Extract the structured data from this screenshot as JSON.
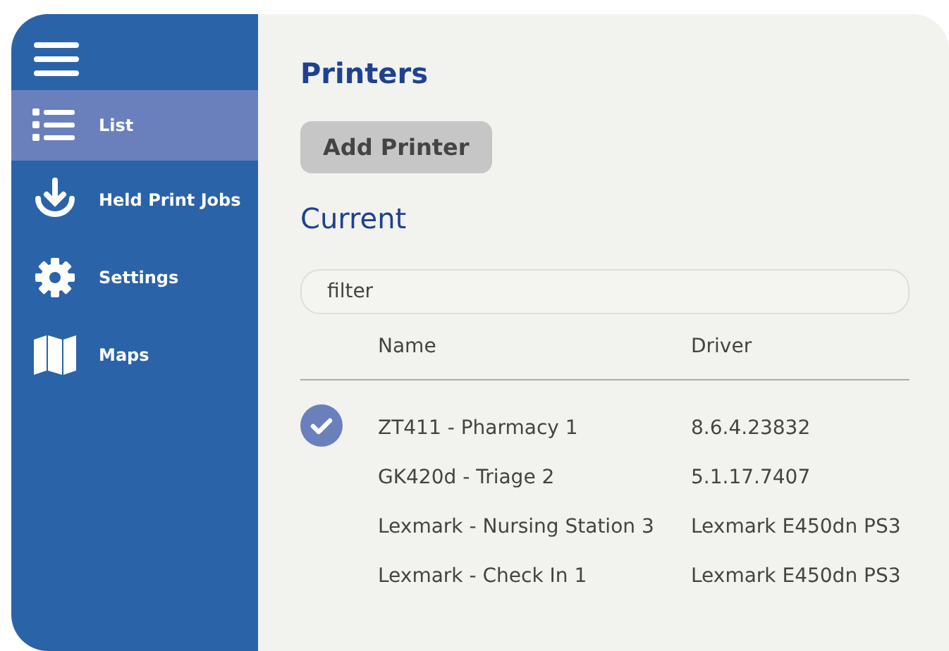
{
  "sidebar": {
    "items": [
      {
        "label": "List",
        "kind": "list",
        "selected": true
      },
      {
        "label": "Held Print Jobs",
        "kind": "download",
        "selected": false
      },
      {
        "label": "Settings",
        "kind": "gear",
        "selected": false
      },
      {
        "label": "Maps",
        "kind": "map",
        "selected": false
      }
    ]
  },
  "main": {
    "title": "Printers",
    "add_button": "Add Printer",
    "section": "Current",
    "filter": {
      "placeholder": "filter"
    },
    "table": {
      "columns": [
        "Name",
        "Driver"
      ],
      "rows": [
        {
          "name": "ZT411 - Pharmacy 1",
          "driver": "8.6.4.23832",
          "selected": true
        },
        {
          "name": "GK420d - Triage 2",
          "driver": "5.1.17.7407",
          "selected": false
        },
        {
          "name": "Lexmark - Nursing Station 3",
          "driver": "Lexmark E450dn PS3",
          "selected": false
        },
        {
          "name": "Lexmark - Check In 1",
          "driver": "Lexmark E450dn PS3",
          "selected": false
        }
      ]
    }
  }
}
